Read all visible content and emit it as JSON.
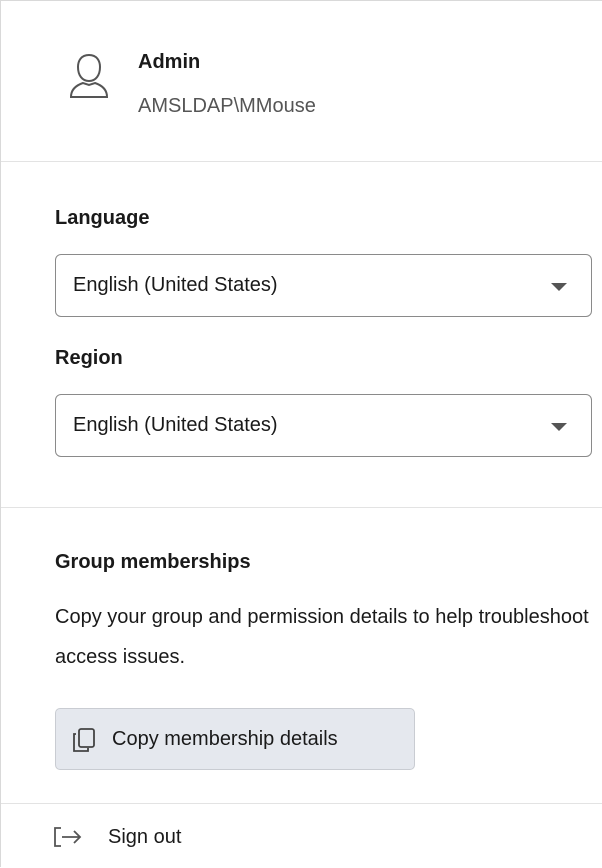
{
  "user": {
    "name": "Admin",
    "account": "AMSLDAP\\MMouse",
    "avatar_icon": "user-silhouette-icon"
  },
  "language": {
    "label": "Language",
    "selected": "English (United States)"
  },
  "region": {
    "label": "Region",
    "selected": "English (United States)"
  },
  "groups": {
    "title": "Group memberships",
    "description": "Copy your group and permission details to help troubleshoot access issues.",
    "copy_button_label": "Copy membership details",
    "copy_icon": "copy-icon"
  },
  "signout": {
    "label": "Sign out",
    "icon": "sign-out-arrow-icon"
  },
  "colors": {
    "button_bg": "#e5e8ee",
    "divider": "#e3e3e3",
    "select_border": "#8a8a8a"
  }
}
